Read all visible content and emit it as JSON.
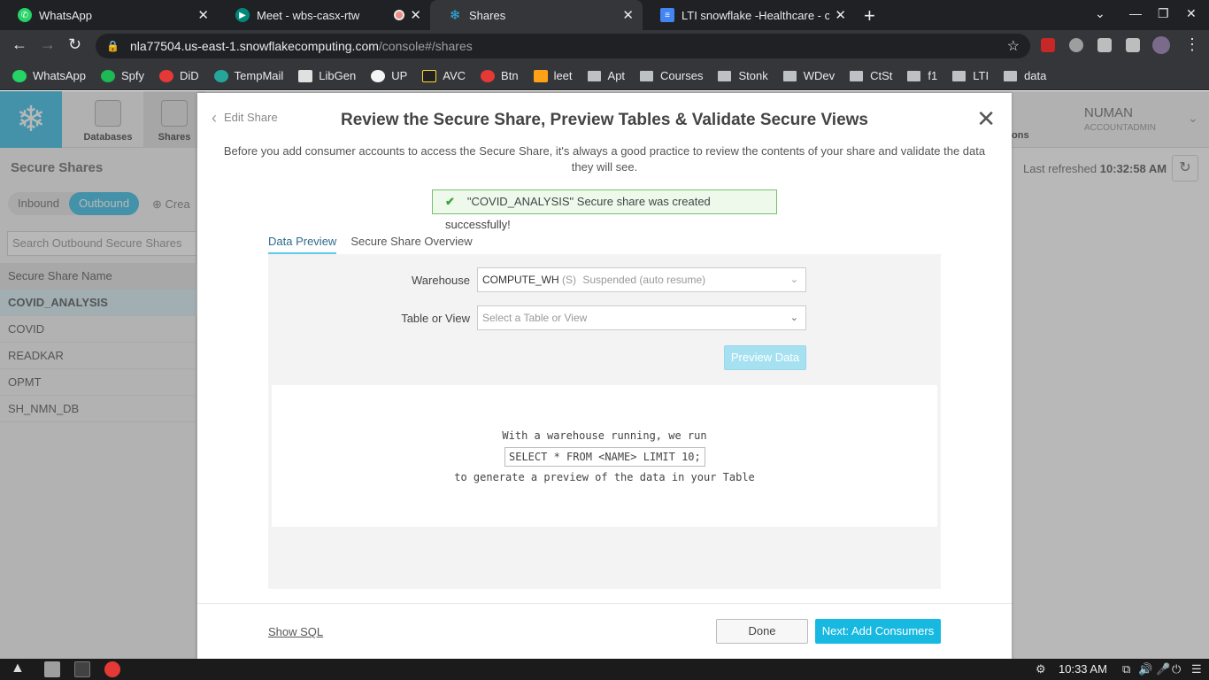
{
  "browser": {
    "tabs": [
      {
        "title": "WhatsApp",
        "color": "#25d366"
      },
      {
        "title": "Meet - wbs-casx-rtw",
        "color": "#00897b"
      },
      {
        "title": "Shares",
        "color": "#29b5e8"
      },
      {
        "title": "LTI snowflake -Healthcare - co",
        "color": "#4285f4"
      }
    ],
    "url_host": "nla77504.us-east-1.snowflakecomputing.com",
    "url_path": "/console#/shares",
    "bookmarks": [
      "WhatsApp",
      "Spfy",
      "DiD",
      "TempMail",
      "LibGen",
      "UP",
      "AVC",
      "Btn",
      "leet"
    ],
    "bookmark_folders": [
      "Apt",
      "Courses",
      "Stonk",
      "WDev",
      "CtSt",
      "f1",
      "LTI",
      "data"
    ]
  },
  "app": {
    "nav": {
      "databases": "Databases",
      "shares": "Shares",
      "partial_right": "ons"
    },
    "user": {
      "name": "NUMAN",
      "role": "ACCOUNTADMIN"
    },
    "left": {
      "title": "Secure Shares",
      "inbound": "Inbound",
      "outbound": "Outbound",
      "create": "Crea",
      "search_placeholder": "Search Outbound Secure Shares",
      "column_header": "Secure Share Name",
      "rows": [
        "COVID_ANALYSIS",
        "COVID",
        "READKAR",
        "OPMT",
        "SH_NMN_DB"
      ]
    },
    "refresh": {
      "label": "Last refreshed",
      "time": "10:32:58 AM"
    }
  },
  "modal": {
    "back_label": "Edit Share",
    "title": "Review the Secure Share, Preview Tables & Validate Secure Views",
    "description": "Before you add consumer accounts to access the Secure Share, it's always a good practice to review the contents of your share and validate the data they will see.",
    "success": "\"COVID_ANALYSIS\" Secure share was created successfully!",
    "tabs": [
      "Data Preview",
      "Secure Share Overview"
    ],
    "warehouse_label": "Warehouse",
    "warehouse_name": "COMPUTE_WH",
    "warehouse_size": "(S)",
    "warehouse_status": "Suspended (auto resume)",
    "table_label": "Table or View",
    "table_placeholder": "Select a Table or View",
    "preview_button": "Preview Data",
    "preview_line1": "With a warehouse running, we run",
    "preview_code": "SELECT * FROM <NAME> LIMIT 10;",
    "preview_line3": "to generate a preview of the data in your Table",
    "show_sql": "Show SQL",
    "done": "Done",
    "next": "Next: Add Consumers"
  },
  "taskbar": {
    "time": "10:33 AM"
  }
}
